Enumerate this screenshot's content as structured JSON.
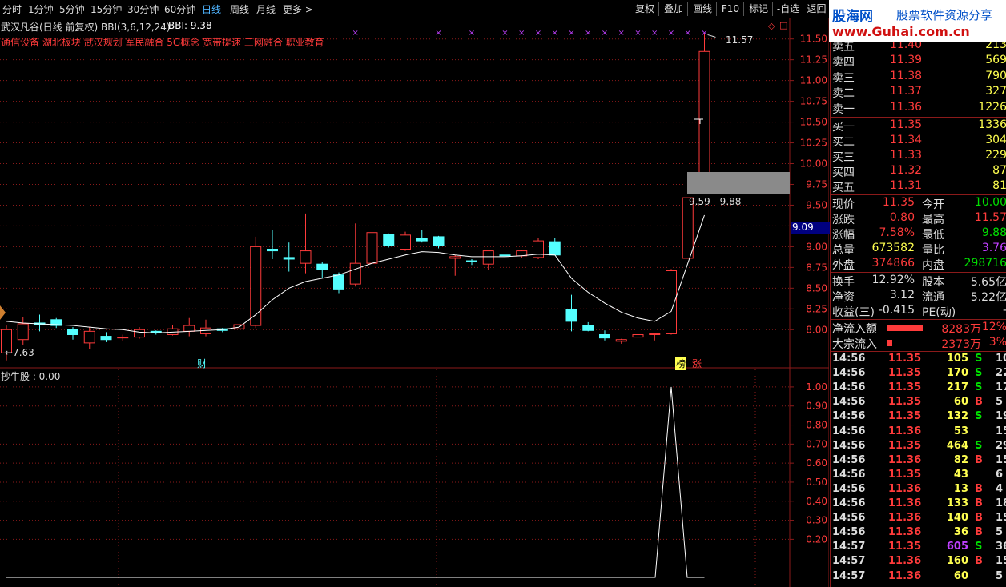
{
  "toolbar": {
    "periods": [
      "分时",
      "1分钟",
      "5分钟",
      "15分钟",
      "30分钟",
      "60分钟",
      "日线",
      "周线",
      "月线",
      "更多 >"
    ],
    "active": "日线",
    "right_buttons": [
      "复权",
      "叠加",
      "画线",
      "F10",
      "标记",
      "-自选",
      "返回"
    ]
  },
  "logo": {
    "cn": "股海网",
    "sub": "股票软件资源分享",
    "url": "www.Guhai.com.cn"
  },
  "chart_header": {
    "title": "武汉凡谷(日线 前复权) BBI(3,6,12,24)",
    "bbi": "BBI: 9.38",
    "concepts": "通信设备 湖北板块 武汉规划 军民融合 5G概念 宽带提速 三网融合 职业教育"
  },
  "annotations": {
    "high": "11.57",
    "low": "←7.63",
    "range": "9.59 - 9.88",
    "price_tag": "9.09",
    "cai": "财",
    "bang": "榜",
    "zhang": "涨",
    "indicator": "抄牛股 : 0.00"
  },
  "colors": {
    "up": "#ff3b3b",
    "down": "#54ffff",
    "grid": "#8b1a1a",
    "text_red": "#ff3b3b",
    "text_green": "#00e000",
    "text_yellow": "#ffff50",
    "text_purple": "#c040ff"
  },
  "chart_data": [
    {
      "type": "candlestick",
      "title": "武汉凡谷(日线 前复权) BBI(3,6,12,24)",
      "ylim": [
        7.55,
        11.68
      ],
      "yticks": [
        "11.50",
        "11.25",
        "11.00",
        "10.75",
        "10.50",
        "10.25",
        "10.00",
        "9.75",
        "9.50",
        "9.25",
        "9.00",
        "8.75",
        "8.50",
        "8.25",
        "8.00"
      ],
      "candles": [
        {
          "o": 7.72,
          "h": 8.05,
          "l": 7.63,
          "c": 8.0
        },
        {
          "o": 7.88,
          "h": 8.15,
          "l": 7.82,
          "c": 8.07
        },
        {
          "o": 8.08,
          "h": 8.18,
          "l": 7.98,
          "c": 8.06
        },
        {
          "o": 8.12,
          "h": 8.14,
          "l": 8.02,
          "c": 8.05
        },
        {
          "o": 8.0,
          "h": 8.03,
          "l": 7.88,
          "c": 7.94
        },
        {
          "o": 7.84,
          "h": 8.03,
          "l": 7.77,
          "c": 7.98
        },
        {
          "o": 7.92,
          "h": 7.97,
          "l": 7.85,
          "c": 7.88
        },
        {
          "o": 7.9,
          "h": 7.94,
          "l": 7.86,
          "c": 7.91
        },
        {
          "o": 7.91,
          "h": 8.03,
          "l": 7.89,
          "c": 8.0
        },
        {
          "o": 7.98,
          "h": 7.99,
          "l": 7.94,
          "c": 7.96
        },
        {
          "o": 7.94,
          "h": 8.06,
          "l": 7.93,
          "c": 8.01
        },
        {
          "o": 7.98,
          "h": 8.14,
          "l": 7.92,
          "c": 8.05
        },
        {
          "o": 7.95,
          "h": 8.12,
          "l": 7.92,
          "c": 8.02
        },
        {
          "o": 8.01,
          "h": 8.02,
          "l": 7.97,
          "c": 7.99
        },
        {
          "o": 8.01,
          "h": 8.08,
          "l": 8.0,
          "c": 8.06
        },
        {
          "o": 8.05,
          "h": 9.12,
          "l": 8.02,
          "c": 9.0
        },
        {
          "o": 8.97,
          "h": 9.2,
          "l": 8.85,
          "c": 8.95
        },
        {
          "o": 8.87,
          "h": 9.05,
          "l": 8.7,
          "c": 8.85
        },
        {
          "o": 8.8,
          "h": 9.4,
          "l": 8.68,
          "c": 8.95
        },
        {
          "o": 8.79,
          "h": 8.82,
          "l": 8.62,
          "c": 8.72
        },
        {
          "o": 8.66,
          "h": 8.69,
          "l": 8.44,
          "c": 8.49
        },
        {
          "o": 8.55,
          "h": 9.28,
          "l": 8.52,
          "c": 8.8
        },
        {
          "o": 8.8,
          "h": 9.22,
          "l": 8.78,
          "c": 9.17
        },
        {
          "o": 9.15,
          "h": 9.16,
          "l": 8.99,
          "c": 9.01
        },
        {
          "o": 8.97,
          "h": 9.18,
          "l": 8.95,
          "c": 9.14
        },
        {
          "o": 9.1,
          "h": 9.2,
          "l": 9.05,
          "c": 9.07
        },
        {
          "o": 9.12,
          "h": 9.13,
          "l": 8.98,
          "c": 9.01
        },
        {
          "o": 8.86,
          "h": 8.9,
          "l": 8.65,
          "c": 8.88
        },
        {
          "o": 8.83,
          "h": 8.85,
          "l": 8.78,
          "c": 8.82
        },
        {
          "o": 8.79,
          "h": 8.95,
          "l": 8.72,
          "c": 8.95
        },
        {
          "o": 8.9,
          "h": 9.02,
          "l": 8.87,
          "c": 8.89
        },
        {
          "o": 8.89,
          "h": 8.96,
          "l": 8.86,
          "c": 8.95
        },
        {
          "o": 8.87,
          "h": 9.1,
          "l": 8.85,
          "c": 9.07
        },
        {
          "o": 9.06,
          "h": 9.1,
          "l": 8.9,
          "c": 8.9
        },
        {
          "o": 8.24,
          "h": 8.42,
          "l": 7.98,
          "c": 8.1
        },
        {
          "o": 8.05,
          "h": 8.09,
          "l": 7.98,
          "c": 7.99
        },
        {
          "o": 7.94,
          "h": 7.99,
          "l": 7.87,
          "c": 7.9
        },
        {
          "o": 7.86,
          "h": 7.89,
          "l": 7.83,
          "c": 7.88
        },
        {
          "o": 7.91,
          "h": 7.96,
          "l": 7.9,
          "c": 7.94
        },
        {
          "o": 7.94,
          "h": 7.96,
          "l": 7.87,
          "c": 7.95
        },
        {
          "o": 7.95,
          "h": 8.73,
          "l": 7.94,
          "c": 8.71
        },
        {
          "o": 8.86,
          "h": 9.59,
          "l": 8.86,
          "c": 9.59
        },
        {
          "o": 9.88,
          "h": 11.57,
          "l": 9.88,
          "c": 11.35
        }
      ],
      "bbi": [
        8.1,
        8.08,
        8.07,
        8.06,
        8.05,
        8.03,
        8.01,
        8.0,
        7.97,
        7.96,
        7.97,
        7.98,
        7.99,
        8.0,
        8.03,
        8.18,
        8.36,
        8.5,
        8.58,
        8.62,
        8.66,
        8.73,
        8.8,
        8.85,
        8.9,
        8.94,
        8.93,
        8.9,
        8.88,
        8.88,
        8.88,
        8.89,
        8.91,
        8.9,
        8.62,
        8.45,
        8.32,
        8.21,
        8.14,
        8.1,
        8.22,
        8.8,
        9.38
      ],
      "markers_top_x_indices": [
        21,
        26,
        28,
        30,
        31,
        32,
        33,
        34,
        35,
        36,
        37,
        38,
        39,
        40,
        41,
        42
      ]
    },
    {
      "type": "line",
      "title": "抄牛股 : 0.00",
      "ylim": [
        0,
        1.05
      ],
      "yticks": [
        "1.00",
        "0.90",
        "0.80",
        "0.70",
        "0.60",
        "0.50",
        "0.40",
        "0.30",
        "0.20"
      ],
      "values": [
        0,
        0,
        0,
        0,
        0,
        0,
        0,
        0,
        0,
        0,
        0,
        0,
        0,
        0,
        0,
        0,
        0,
        0,
        0,
        0,
        0,
        0,
        0,
        0,
        0,
        0,
        0,
        0,
        0,
        0,
        0,
        0,
        0,
        0,
        0,
        0,
        0,
        0,
        0,
        0,
        1,
        0,
        0
      ]
    }
  ],
  "quote": {
    "asks": [
      {
        "label": "卖五",
        "price": "11.40",
        "vol": "213"
      },
      {
        "label": "卖四",
        "price": "11.39",
        "vol": "569"
      },
      {
        "label": "卖三",
        "price": "11.38",
        "vol": "790"
      },
      {
        "label": "卖二",
        "price": "11.37",
        "vol": "327"
      },
      {
        "label": "卖一",
        "price": "11.36",
        "vol": "1226"
      }
    ],
    "bids": [
      {
        "label": "买一",
        "price": "11.35",
        "vol": "1336"
      },
      {
        "label": "买二",
        "price": "11.34",
        "vol": "304"
      },
      {
        "label": "买三",
        "price": "11.33",
        "vol": "229"
      },
      {
        "label": "买四",
        "price": "11.32",
        "vol": "87"
      },
      {
        "label": "买五",
        "price": "11.31",
        "vol": "81"
      }
    ],
    "stats": [
      {
        "l1": "现价",
        "v1": "11.35",
        "c1": "red",
        "l2": "今开",
        "v2": "10.00",
        "c2": "green"
      },
      {
        "l1": "涨跌",
        "v1": "0.80",
        "c1": "red",
        "l2": "最高",
        "v2": "11.57",
        "c2": "red"
      },
      {
        "l1": "涨幅",
        "v1": "7.58%",
        "c1": "red",
        "l2": "最低",
        "v2": "9.88",
        "c2": "green"
      },
      {
        "l1": "总量",
        "v1": "673582",
        "c1": "yellow",
        "l2": "量比",
        "v2": "3.76",
        "c2": "purple"
      },
      {
        "l1": "外盘",
        "v1": "374866",
        "c1": "red",
        "l2": "内盘",
        "v2": "298716",
        "c2": "green"
      }
    ],
    "fundamentals": [
      {
        "l1": "换手",
        "v1": "12.92%",
        "l2": "股本",
        "v2": "5.65亿"
      },
      {
        "l1": "净资",
        "v1": "3.12",
        "l2": "流通",
        "v2": "5.22亿"
      },
      {
        "l1": "收益(三)",
        "v1": "-0.415",
        "l2": "PE(动)",
        "v2": "-"
      }
    ],
    "flows": [
      {
        "label": "净流入额",
        "amount": "8283万",
        "pct": "12%",
        "bar": 0.52
      },
      {
        "label": "大宗流入",
        "amount": "2373万",
        "pct": "3%",
        "bar": 0.08
      }
    ]
  },
  "ticks": [
    {
      "t": "14:56",
      "p": "11.35",
      "v": "105",
      "s": "S",
      "n": "10"
    },
    {
      "t": "14:56",
      "p": "11.35",
      "v": "170",
      "s": "S",
      "n": "22"
    },
    {
      "t": "14:56",
      "p": "11.35",
      "v": "217",
      "s": "S",
      "n": "17"
    },
    {
      "t": "14:56",
      "p": "11.35",
      "v": "60",
      "s": "B",
      "n": "5"
    },
    {
      "t": "14:56",
      "p": "11.35",
      "v": "132",
      "s": "S",
      "n": "19"
    },
    {
      "t": "14:56",
      "p": "11.36",
      "v": "53",
      "s": "",
      "n": "15"
    },
    {
      "t": "14:56",
      "p": "11.35",
      "v": "464",
      "s": "S",
      "n": "29"
    },
    {
      "t": "14:56",
      "p": "11.36",
      "v": "82",
      "s": "B",
      "n": "15"
    },
    {
      "t": "14:56",
      "p": "11.35",
      "v": "43",
      "s": "",
      "n": "6"
    },
    {
      "t": "14:56",
      "p": "11.36",
      "v": "13",
      "s": "B",
      "n": "4"
    },
    {
      "t": "14:56",
      "p": "11.36",
      "v": "133",
      "s": "B",
      "n": "18"
    },
    {
      "t": "14:56",
      "p": "11.36",
      "v": "140",
      "s": "B",
      "n": "15"
    },
    {
      "t": "14:56",
      "p": "11.36",
      "v": "36",
      "s": "B",
      "n": "5"
    },
    {
      "t": "14:57",
      "p": "11.35",
      "v": "605",
      "s": "S",
      "n": "36"
    },
    {
      "t": "14:57",
      "p": "11.36",
      "v": "160",
      "s": "B",
      "n": "15"
    },
    {
      "t": "14:57",
      "p": "11.36",
      "v": "60",
      "s": "",
      "n": "5"
    }
  ]
}
